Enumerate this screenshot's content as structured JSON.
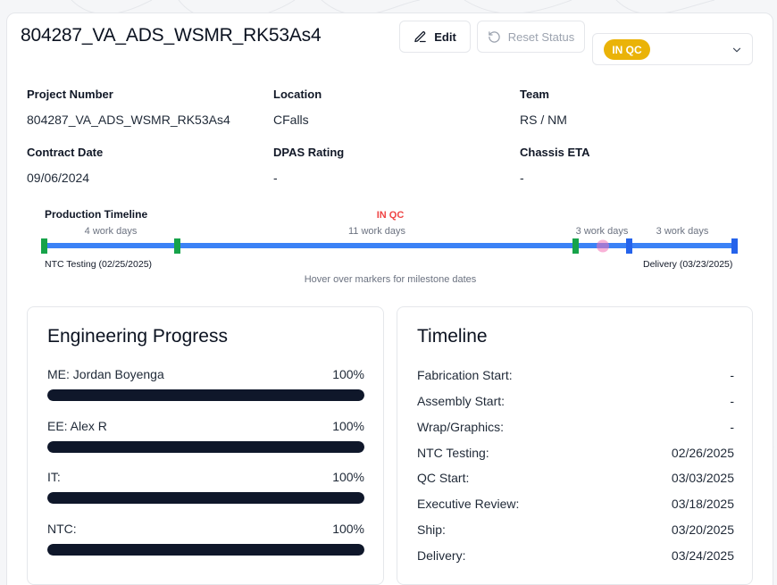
{
  "header": {
    "title": "804287_VA_ADS_WSMR_RK53As4",
    "edit_label": "Edit",
    "reset_label": "Reset Status",
    "status": "IN QC",
    "status_color": "#eab308"
  },
  "info": [
    {
      "label": "Project Number",
      "value": "804287_VA_ADS_WSMR_RK53As4"
    },
    {
      "label": "Location",
      "value": "CFalls"
    },
    {
      "label": "Team",
      "value": "RS / NM"
    },
    {
      "label": "Contract Date",
      "value": "09/06/2024"
    },
    {
      "label": "DPAS Rating",
      "value": "-"
    },
    {
      "label": "Chassis ETA",
      "value": "-"
    }
  ],
  "production_timeline": {
    "title": "Production Timeline",
    "current_stage": "IN QC",
    "segments": [
      "4 work days",
      "11 work days",
      "3 work days",
      "3 work days"
    ],
    "start_label": "NTC Testing (02/25/2025)",
    "end_label": "Delivery (03/23/2025)",
    "hint": "Hover over markers for milestone dates",
    "colors": {
      "bar": "#3b82f6",
      "milestone_done": "#16a34a",
      "milestone_future": "#2563eb",
      "current": "#f472b6"
    }
  },
  "engineering": {
    "title": "Engineering Progress",
    "items": [
      {
        "label": "ME: Jordan Boyenga",
        "value": "100%",
        "fraction": 1.0
      },
      {
        "label": "EE: Alex R",
        "value": "100%",
        "fraction": 1.0
      },
      {
        "label": "IT:",
        "value": "100%",
        "fraction": 1.0
      },
      {
        "label": "NTC:",
        "value": "100%",
        "fraction": 1.0
      }
    ]
  },
  "timeline": {
    "title": "Timeline",
    "rows": [
      {
        "label": "Fabrication Start:",
        "value": "-"
      },
      {
        "label": "Assembly Start:",
        "value": "-"
      },
      {
        "label": "Wrap/Graphics:",
        "value": "-"
      },
      {
        "label": "NTC Testing:",
        "value": "02/26/2025"
      },
      {
        "label": "QC Start:",
        "value": "03/03/2025"
      },
      {
        "label": "Executive Review:",
        "value": "03/18/2025"
      },
      {
        "label": "Ship:",
        "value": "03/20/2025"
      },
      {
        "label": "Delivery:",
        "value": "03/24/2025"
      }
    ]
  }
}
